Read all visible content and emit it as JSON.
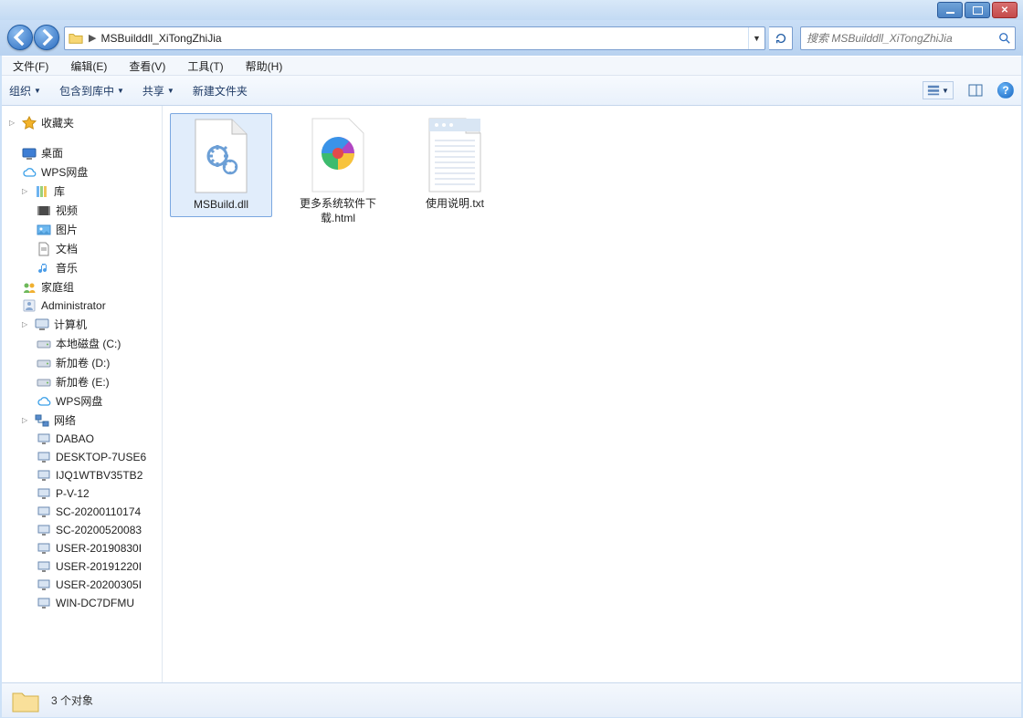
{
  "titlebar": {
    "blur_text": "   "
  },
  "address": {
    "path": "MSBuilddll_XiTongZhiJia"
  },
  "search": {
    "placeholder": "搜索 MSBuilddll_XiTongZhiJia"
  },
  "menubar": {
    "items": [
      "文件(F)",
      "编辑(E)",
      "查看(V)",
      "工具(T)",
      "帮助(H)"
    ]
  },
  "toolbar": {
    "organize": "组织",
    "include": "包含到库中",
    "share": "共享",
    "newfolder": "新建文件夹"
  },
  "sidebar": {
    "favorites": "收藏夹",
    "desktop": "桌面",
    "wps": "WPS网盘",
    "libraries": "库",
    "videos": "视频",
    "pictures": "图片",
    "documents": "文档",
    "music": "音乐",
    "homegroup": "家庭组",
    "admin": "Administrator",
    "computer": "计算机",
    "drive_c": "本地磁盘 (C:)",
    "drive_d": "新加卷 (D:)",
    "drive_e": "新加卷 (E:)",
    "wps2": "WPS网盘",
    "network": "网络",
    "net": [
      "DABAO",
      "DESKTOP-7USE6",
      "IJQ1WTBV35TB2",
      "P-V-12",
      "SC-20200110174",
      "SC-20200520083",
      "USER-20190830I",
      "USER-20191220I",
      "USER-20200305I",
      "WIN-DC7DFMU"
    ]
  },
  "files": [
    {
      "name": "MSBuild.dll",
      "type": "dll"
    },
    {
      "name": "更多系统软件下载.html",
      "type": "html"
    },
    {
      "name": "使用说明.txt",
      "type": "txt"
    }
  ],
  "status": {
    "text": "3 个对象"
  }
}
